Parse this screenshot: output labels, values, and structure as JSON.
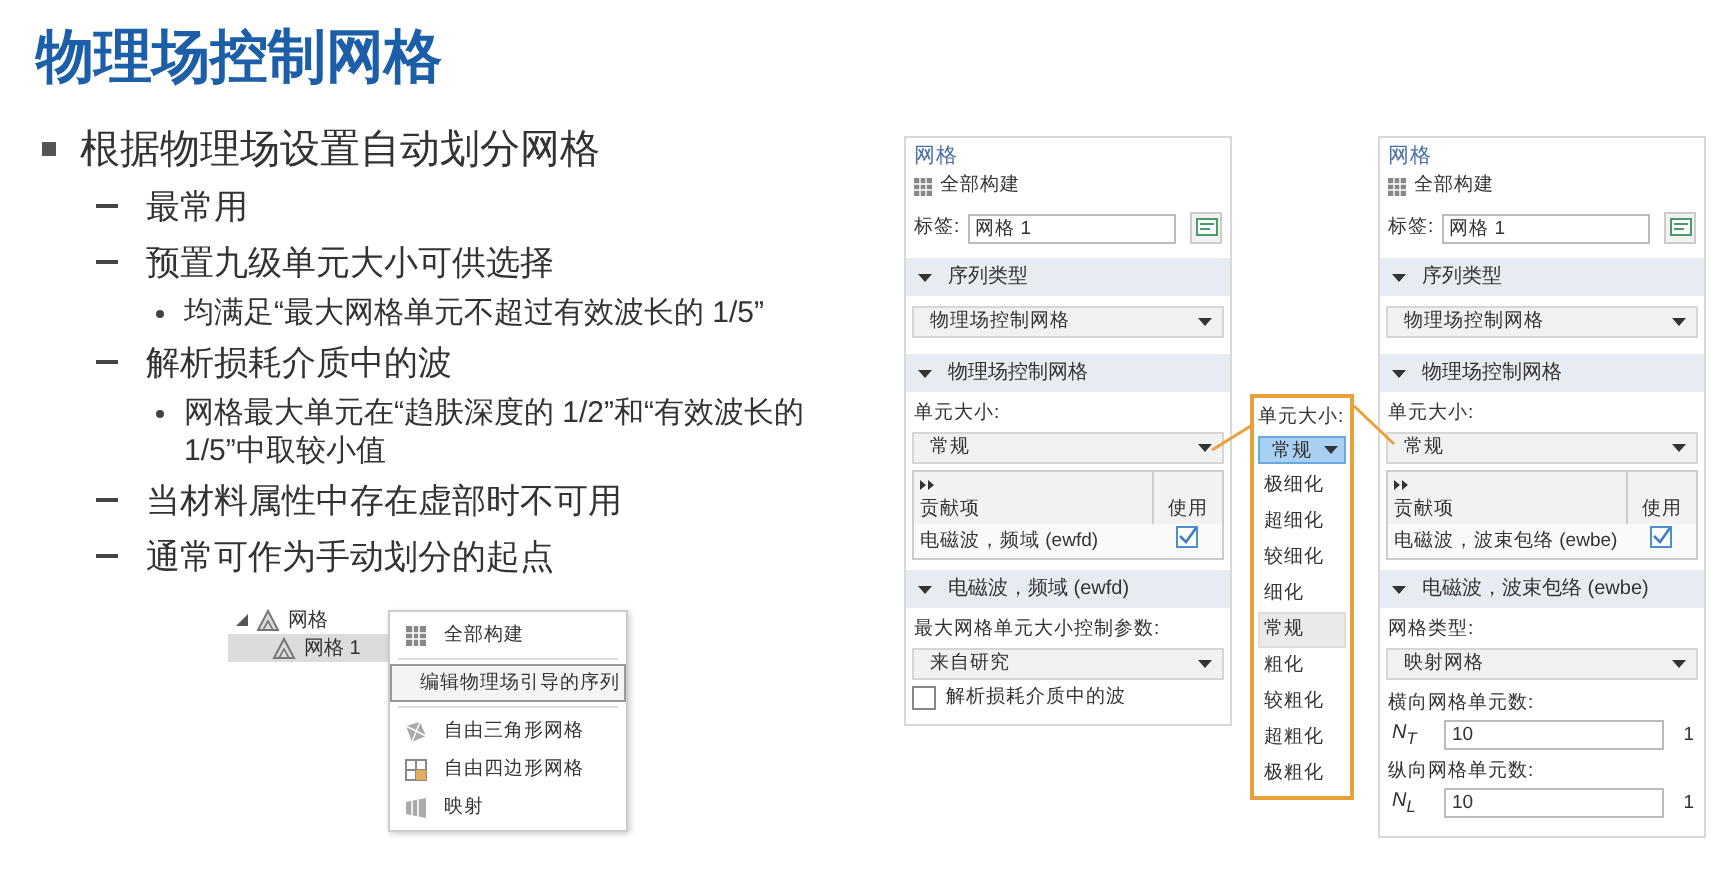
{
  "title": "物理场控制网格",
  "bullets": [
    {
      "text": "根据物理场设置自动划分网格",
      "children": [
        {
          "text": "最常用"
        },
        {
          "text": "预置九级单元大小可供选择",
          "children": [
            {
              "text": "均满足“最大网格单元不超过有效波长的 1/5”"
            }
          ]
        },
        {
          "text": "解析损耗介质中的波",
          "children": [
            {
              "text": "网格最大单元在“趋肤深度的 1/2”和“有效波长的 1/5”中取较小值"
            }
          ]
        },
        {
          "text": "当材料属性中存在虚部时不可用"
        },
        {
          "text": "通常可作为手动划分的起点"
        }
      ]
    }
  ],
  "model_tree": {
    "items": [
      {
        "label": "网格",
        "expanded": true,
        "selected": false,
        "children": [
          {
            "label": "网格 1",
            "selected": true
          }
        ]
      }
    ]
  },
  "context_menu": {
    "items": [
      {
        "label": "全部构建",
        "selected": false
      },
      {
        "label": "编辑物理场引导的序列",
        "selected": true
      },
      {
        "label": "自由三角形网格",
        "selected": false
      },
      {
        "label": "自由四边形网格",
        "selected": false
      },
      {
        "label": "映射",
        "selected": false
      }
    ]
  },
  "left_panel": {
    "heading": "网格",
    "build_all": "全部构建",
    "label_caption": "标签:",
    "label_value": "网格 1",
    "sections": [
      {
        "title": "序列类型",
        "expanded": true,
        "controls": [
          {
            "kind": "select",
            "value": "物理场控制网格"
          }
        ]
      },
      {
        "title": "物理场控制网格",
        "expanded": true,
        "controls": [
          {
            "kind": "label",
            "text": "单元大小:"
          },
          {
            "kind": "select",
            "value": "常规"
          },
          {
            "kind": "table",
            "columns": [
              "贡献项",
              "使用"
            ],
            "rows": [
              {
                "name": "电磁波，频域 (ewfd)",
                "checked": true
              }
            ]
          }
        ]
      },
      {
        "title": "电磁波，频域 (ewfd)",
        "expanded": true,
        "controls": [
          {
            "kind": "label",
            "text": "最大网格单元大小控制参数:"
          },
          {
            "kind": "select",
            "value": "来自研究"
          },
          {
            "kind": "checkbox",
            "text": "解析损耗介质中的波",
            "checked": false
          }
        ]
      }
    ]
  },
  "size_popup": {
    "label": "单元大小:",
    "value": "常规",
    "options": [
      {
        "label": "极细化",
        "selected": false
      },
      {
        "label": "超细化",
        "selected": false
      },
      {
        "label": "较细化",
        "selected": false
      },
      {
        "label": "细化",
        "selected": false
      },
      {
        "label": "常规",
        "selected": true
      },
      {
        "label": "粗化",
        "selected": false
      },
      {
        "label": "较粗化",
        "selected": false
      },
      {
        "label": "超粗化",
        "selected": false
      },
      {
        "label": "极粗化",
        "selected": false
      }
    ]
  },
  "right_panel": {
    "heading": "网格",
    "build_all": "全部构建",
    "label_caption": "标签:",
    "label_value": "网格 1",
    "sections": [
      {
        "title": "序列类型",
        "expanded": true,
        "controls": [
          {
            "kind": "select",
            "value": "物理场控制网格"
          }
        ]
      },
      {
        "title": "物理场控制网格",
        "expanded": true,
        "controls": [
          {
            "kind": "label",
            "text": "单元大小:"
          },
          {
            "kind": "select",
            "value": "常规"
          },
          {
            "kind": "table",
            "columns": [
              "贡献项",
              "使用"
            ],
            "rows": [
              {
                "name": "电磁波，波束包络 (ewbe)",
                "checked": true
              }
            ]
          }
        ]
      },
      {
        "title": "电磁波，波束包络 (ewbe)",
        "expanded": true,
        "controls": [
          {
            "kind": "label",
            "text": "网格类型:"
          },
          {
            "kind": "select",
            "value": "映射网格"
          },
          {
            "kind": "label",
            "text": "横向网格单元数:"
          },
          {
            "kind": "number",
            "symbol": "N$_{T}$",
            "value": "10",
            "unit": "1"
          },
          {
            "kind": "label",
            "text": "纵向网格单元数:"
          },
          {
            "kind": "number",
            "symbol": "N$_{L}$",
            "value": "10",
            "unit": "1"
          }
        ]
      }
    ]
  }
}
